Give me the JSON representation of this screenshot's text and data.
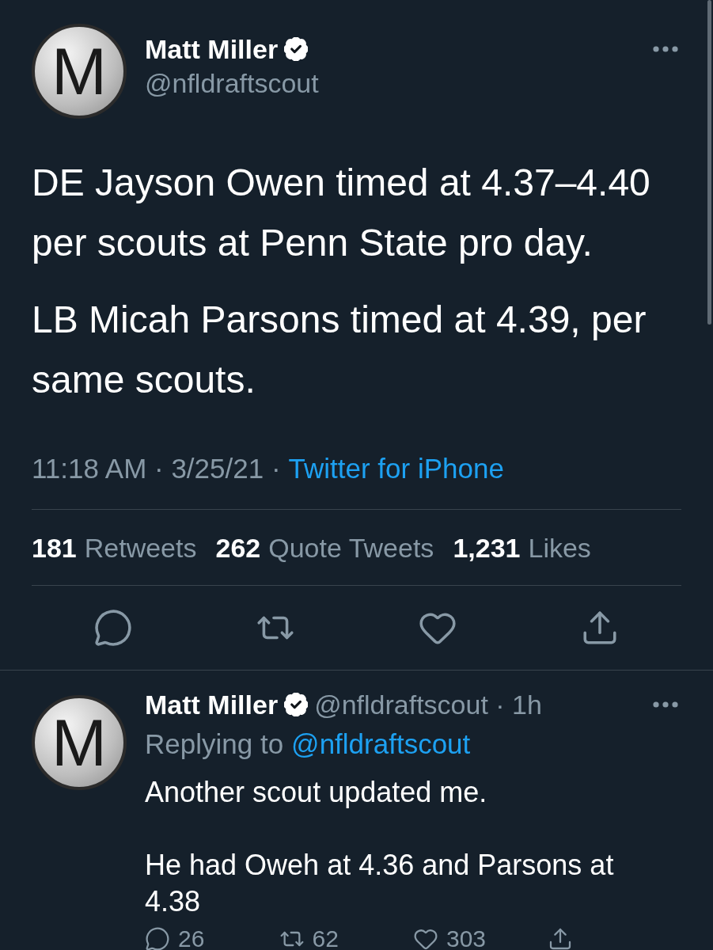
{
  "tweet": {
    "author": {
      "name": "Matt Miller",
      "verified": true,
      "handle": "@nfldraftscout",
      "avatar_letter": "M"
    },
    "paragraphs": [
      "DE Jayson Owen timed at 4.37–4.40 per scouts at Penn State pro day.",
      "LB Micah Parsons timed at 4.39, per same scouts."
    ],
    "timestamp": "11:18 AM · 3/25/21 ·",
    "source": "Twitter for iPhone",
    "stats": [
      {
        "count": "181",
        "label": "Retweets"
      },
      {
        "count": "262",
        "label": "Quote Tweets"
      },
      {
        "count": "1,231",
        "label": "Likes"
      }
    ],
    "actions": [
      {
        "kind": "reply"
      },
      {
        "kind": "retweet"
      },
      {
        "kind": "like"
      },
      {
        "kind": "share"
      }
    ]
  },
  "reply": {
    "author": {
      "name": "Matt Miller",
      "verified": true,
      "handle_time": "@nfldraftscout · 1h",
      "avatar_letter": "M"
    },
    "replying_to": {
      "prefix": "Replying to",
      "handle": "@nfldraftscout"
    },
    "paragraphs": [
      "Another scout updated me.",
      "He had Oweh at 4.36 and Parsons at 4.38"
    ],
    "actions": [
      {
        "kind": "reply",
        "count": "26"
      },
      {
        "kind": "retweet",
        "count": "62"
      },
      {
        "kind": "like",
        "count": "303"
      },
      {
        "kind": "share"
      }
    ]
  }
}
